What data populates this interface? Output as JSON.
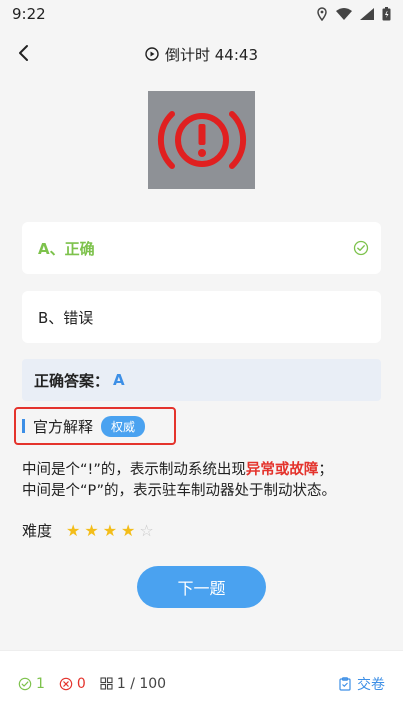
{
  "status": {
    "time": "9:22"
  },
  "header": {
    "timer_label": "倒计时 44:43"
  },
  "question": {
    "image_icon": "brake-warning-icon"
  },
  "options": [
    {
      "label": "A、正确",
      "state": "correct"
    },
    {
      "label": "B、错误",
      "state": "normal"
    }
  ],
  "answer": {
    "label": "正确答案：",
    "value": "A"
  },
  "explanation": {
    "title": "官方解释",
    "badge": "权威",
    "line1_prefix": "中间是个“!”的，表示制动系统出现",
    "line1_highlight": "异常或故障",
    "line1_suffix": "；",
    "line2": "中间是个“P”的，表示驻车制动器处于制动状态。"
  },
  "difficulty": {
    "label": "难度",
    "rating": 4,
    "max": 5
  },
  "next_button": "下一题",
  "bottom": {
    "correct": "1",
    "wrong": "0",
    "progress": "1 / 100",
    "submit": "交卷"
  },
  "colors": {
    "accent": "#4aa2f0",
    "correct": "#7dc24c",
    "wrong": "#e4332c",
    "highlight_box": "#e4332c"
  }
}
